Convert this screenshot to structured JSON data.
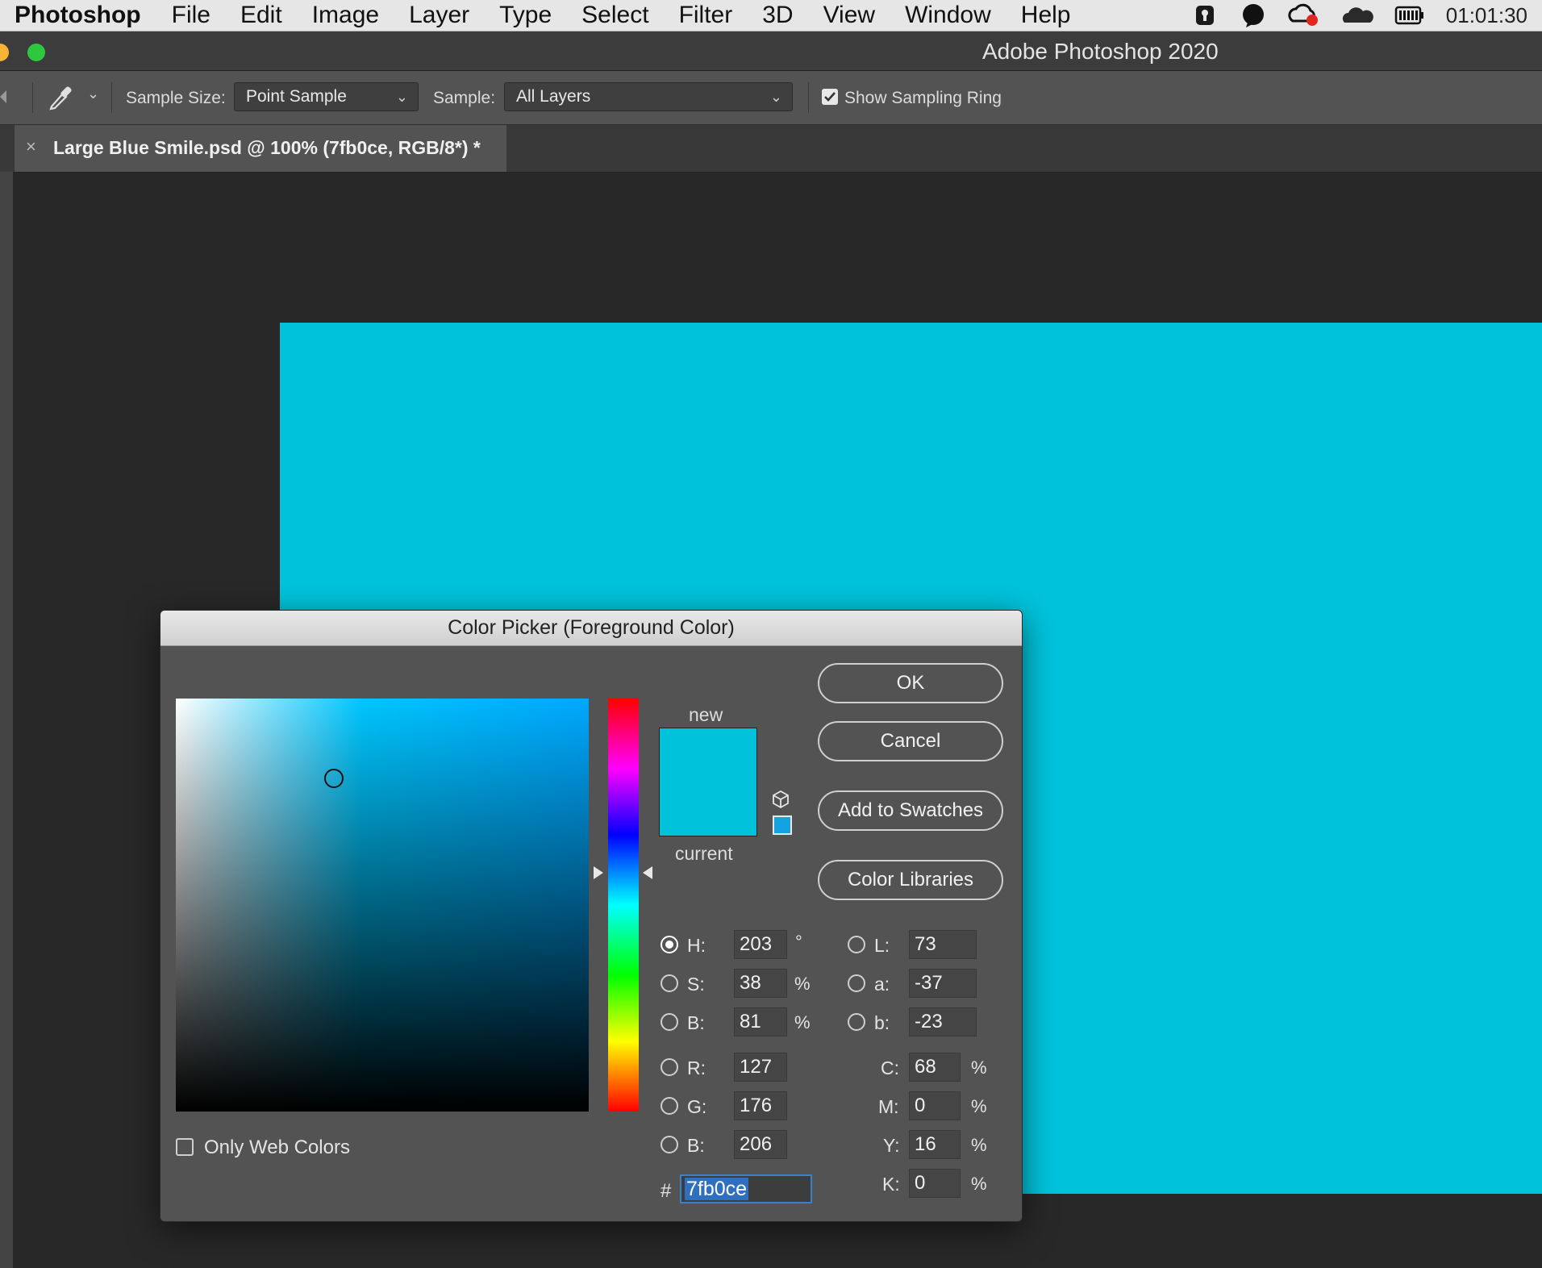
{
  "menubar": {
    "app": "Photoshop",
    "items": [
      "File",
      "Edit",
      "Image",
      "Layer",
      "Type",
      "Select",
      "Filter",
      "3D",
      "View",
      "Window",
      "Help"
    ],
    "clock": "01:01:30",
    "status_icons": [
      "keychain-icon",
      "chat-bubble-icon",
      "creative-cloud-icon",
      "onedrive-icon",
      "battery-icon"
    ]
  },
  "window": {
    "title": "Adobe Photoshop 2020"
  },
  "options_bar": {
    "sample_size_label": "Sample Size:",
    "sample_size_value": "Point Sample",
    "sample_label": "Sample:",
    "sample_value": "All Layers",
    "show_sampling_ring_label": "Show Sampling Ring",
    "show_sampling_ring_checked": true
  },
  "document_tab": {
    "close": "×",
    "title": "Large Blue Smile.psd @ 100% (7fb0ce, RGB/8*) *"
  },
  "canvas": {
    "fill_color": "#00c3db"
  },
  "dialog": {
    "title": "Color Picker (Foreground Color)",
    "new_label": "new",
    "current_label": "current",
    "new_color": "#00c3db",
    "current_color": "#00c3db",
    "buttons": {
      "ok": "OK",
      "cancel": "Cancel",
      "add_to_swatches": "Add to Swatches",
      "color_libraries": "Color Libraries"
    },
    "only_web_colors_label": "Only Web Colors",
    "only_web_colors_checked": false,
    "hsb": {
      "h_label": "H:",
      "h_value": "203",
      "h_unit": "°",
      "s_label": "S:",
      "s_value": "38",
      "s_unit": "%",
      "b_label": "B:",
      "b_value": "81",
      "b_unit": "%"
    },
    "rgb": {
      "r_label": "R:",
      "r_value": "127",
      "g_label": "G:",
      "g_value": "176",
      "b_label": "B:",
      "b_value": "206"
    },
    "lab": {
      "l_label": "L:",
      "l_value": "73",
      "a_label": "a:",
      "a_value": "-37",
      "b_label": "b:",
      "b_value": "-23"
    },
    "cmyk": {
      "c_label": "C:",
      "c_value": "68",
      "c_unit": "%",
      "m_label": "M:",
      "m_value": "0",
      "m_unit": "%",
      "y_label": "Y:",
      "y_value": "16",
      "y_unit": "%",
      "k_label": "K:",
      "k_value": "0",
      "k_unit": "%"
    },
    "hex_prefix": "#",
    "hex_value": "7fb0ce",
    "selected_channel": "H"
  }
}
